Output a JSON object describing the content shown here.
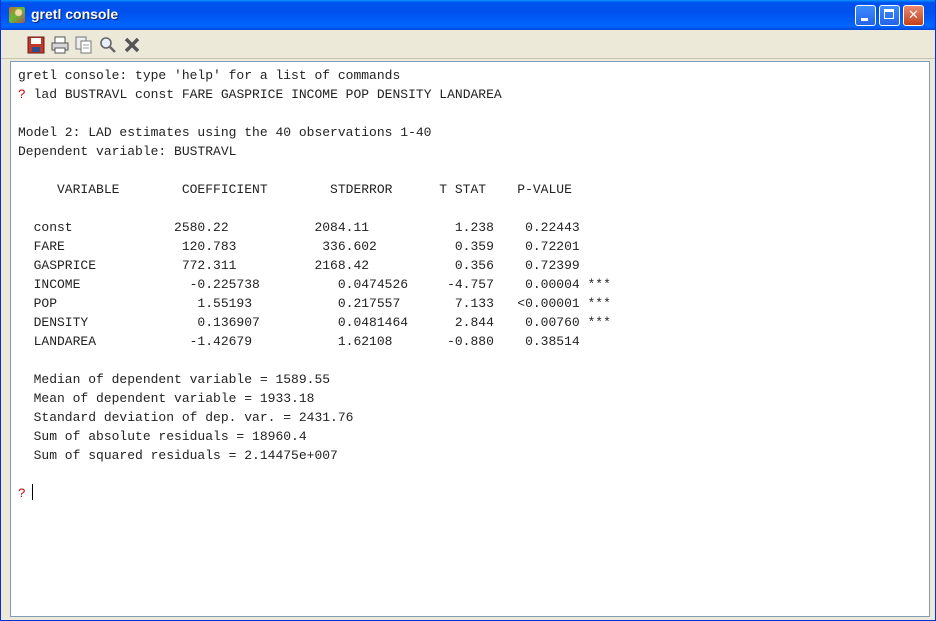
{
  "window": {
    "title": "gretl console",
    "icon": "gretl-icon"
  },
  "toolbar": {
    "buttons": [
      {
        "name": "save-icon"
      },
      {
        "name": "print-icon"
      },
      {
        "name": "copy-icon"
      },
      {
        "name": "find-icon"
      },
      {
        "name": "close-icon"
      }
    ]
  },
  "console": {
    "intro": "gretl console: type 'help' for a list of commands",
    "prompt_symbol": "?",
    "command": "lad BUSTRAVL const FARE GASPRICE INCOME POP DENSITY LANDAREA",
    "model_heading": "Model 2: LAD estimates using the 40 observations 1-40",
    "dependent": "Dependent variable: BUSTRAVL",
    "table_header": "     VARIABLE        COEFFICIENT        STDERROR      T STAT    P-VALUE",
    "rows": [
      "  const             2580.22           2084.11           1.238    0.22443",
      "  FARE               120.783           336.602          0.359    0.72201",
      "  GASPRICE           772.311          2168.42           0.356    0.72399",
      "  INCOME              -0.225738          0.0474526     -4.757    0.00004 ***",
      "  POP                  1.55193           0.217557       7.133   <0.00001 ***",
      "  DENSITY              0.136907          0.0481464      2.844    0.00760 ***",
      "  LANDAREA            -1.42679           1.62108       -0.880    0.38514"
    ],
    "stats": [
      "  Median of dependent variable = 1589.55",
      "  Mean of dependent variable = 1933.18",
      "  Standard deviation of dep. var. = 2431.76",
      "  Sum of absolute residuals = 18960.4",
      "  Sum of squared residuals = 2.14475e+007"
    ],
    "colors": {
      "prompt": "#cc0000",
      "text": "#222222"
    }
  }
}
